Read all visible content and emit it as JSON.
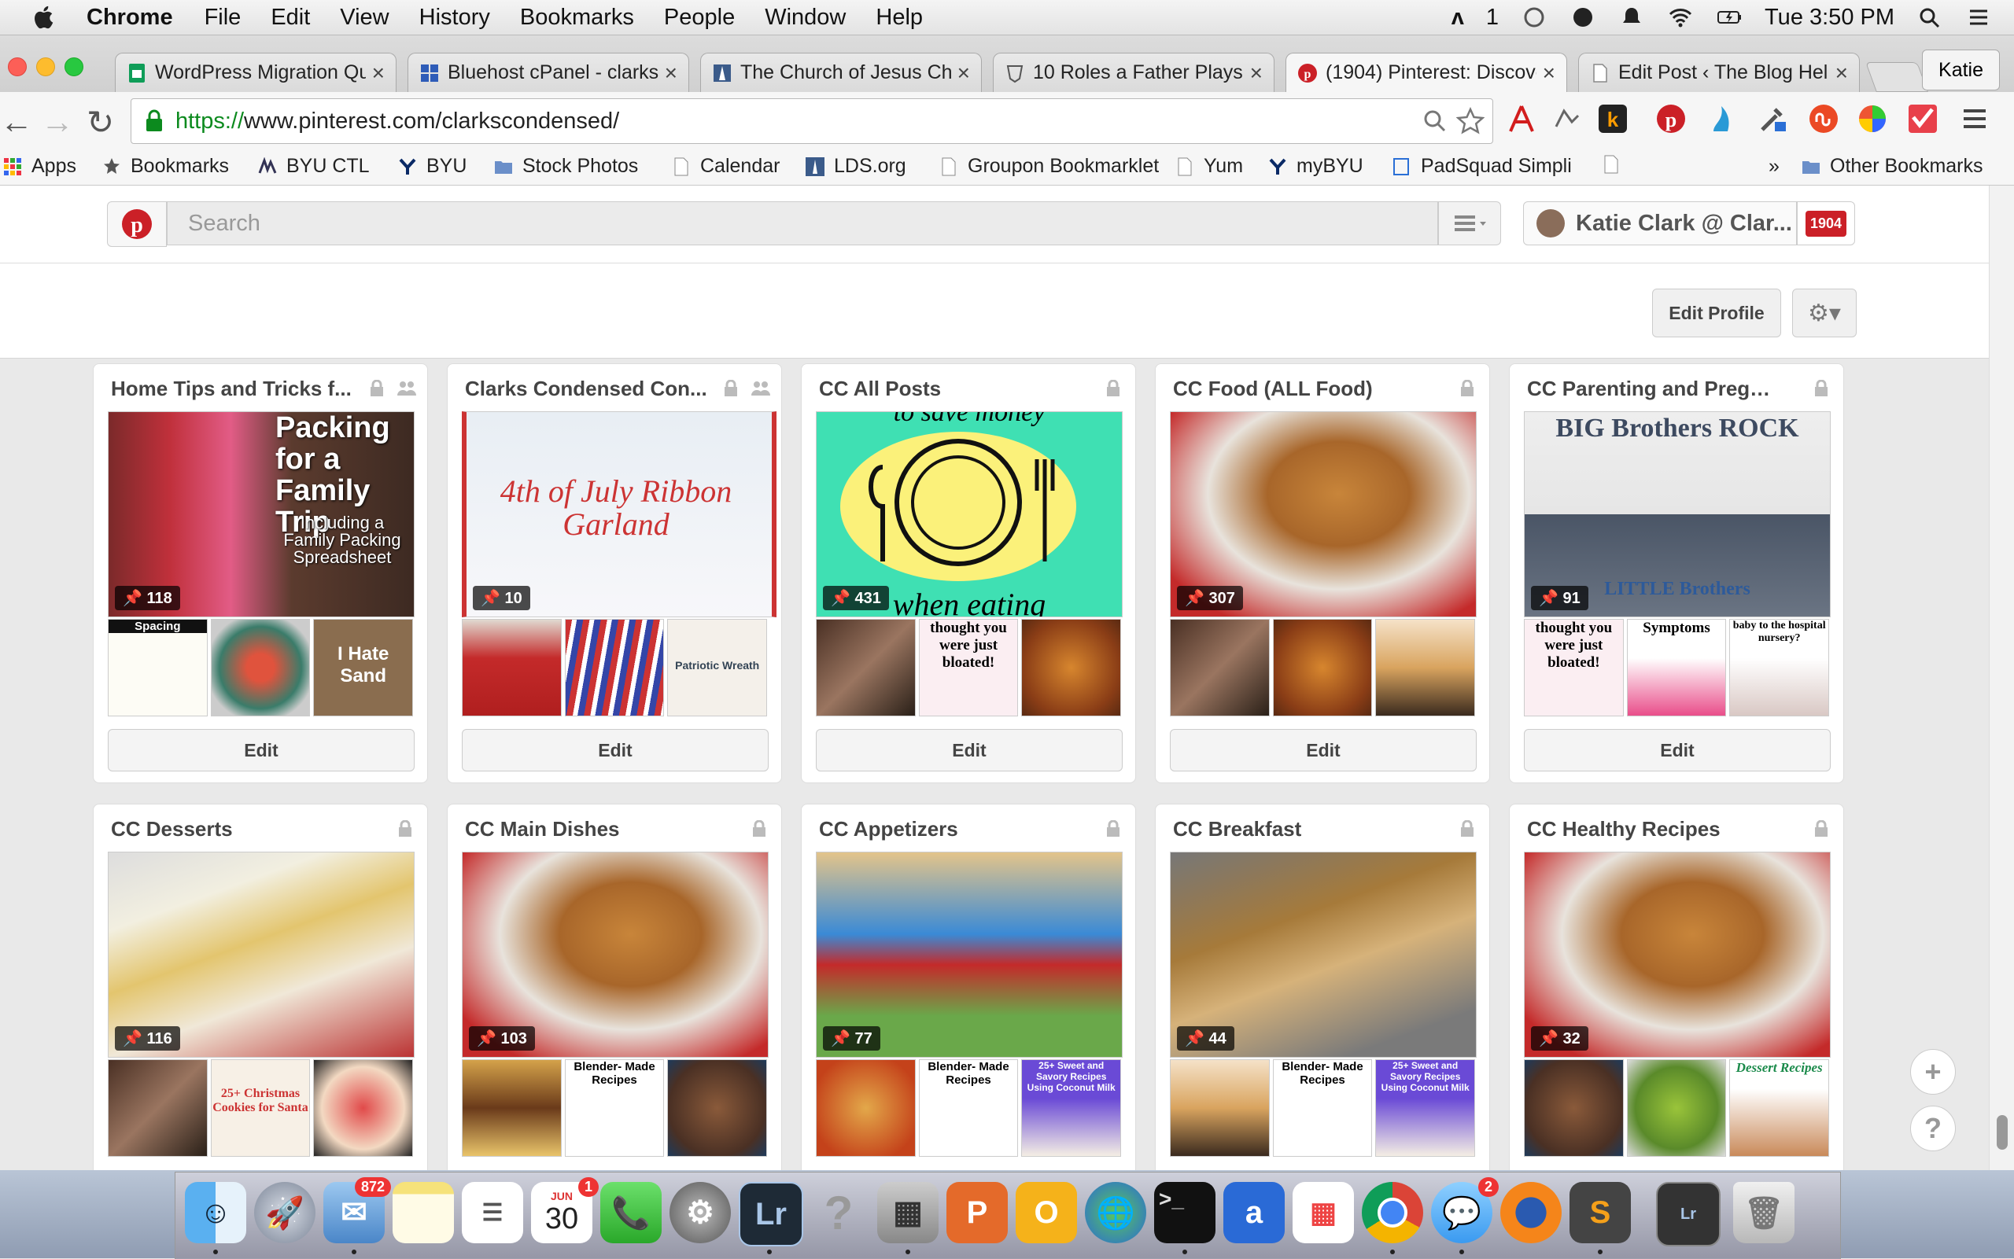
{
  "menubar": {
    "app": "Chrome",
    "items": [
      "File",
      "Edit",
      "View",
      "History",
      "Bookmarks",
      "People",
      "Window",
      "Help"
    ],
    "status_num": "1",
    "clock": "Tue 3:50 PM"
  },
  "tabs": [
    {
      "title": "WordPress Migration Que"
    },
    {
      "title": "Bluehost cPanel - clarksc"
    },
    {
      "title": "The Church of Jesus Chri"
    },
    {
      "title": "10 Roles a Father Plays i"
    },
    {
      "title": "(1904) Pinterest: Discove"
    },
    {
      "title": "Edit Post ‹ The Blog Help"
    }
  ],
  "profile_name": "Katie",
  "url": {
    "scheme": "https://",
    "host_path": "www.pinterest.com/clarkscondensed/"
  },
  "bookmarks": [
    "Apps",
    "Bookmarks",
    "BYU CTL",
    "BYU",
    "Stock Photos",
    "Calendar",
    "LDS.org",
    "Groupon Bookmarklet",
    "Yum",
    "myBYU",
    "PadSquad Simpli",
    "Other Bookmarks"
  ],
  "bookmarks_overflow": "»",
  "pinterest": {
    "search_placeholder": "Search",
    "user_label": "Katie Clark @ Clar...",
    "notif_count": "1904",
    "edit_profile": "Edit Profile"
  },
  "boards": [
    {
      "title": "Home Tips and Tricks f...",
      "count": "118",
      "edit": "Edit",
      "cover_text": "Packing for a Family Trip",
      "cover_sub": "Including a Family Packing Spreadsheet",
      "thumb_texts": [
        "Spacing",
        "",
        "I Hate Sand"
      ]
    },
    {
      "title": "Clarks Condensed Con...",
      "count": "10",
      "edit": "Edit",
      "cover_text": "4th of July Ribbon Garland",
      "cover_sub": "",
      "thumb_texts": [
        "",
        "",
        "Patriotic Wreath"
      ]
    },
    {
      "title": "CC All Posts",
      "count": "431",
      "edit": "Edit",
      "cover_text": "when eating",
      "cover_sub": "to save money",
      "thumb_texts": [
        "",
        "thought you were just bloated!",
        ""
      ]
    },
    {
      "title": "CC Food (ALL Food)",
      "count": "307",
      "edit": "Edit",
      "cover_text": "",
      "cover_sub": "",
      "thumb_texts": [
        "",
        "",
        ""
      ]
    },
    {
      "title": "CC Parenting and Pregnan...",
      "count": "91",
      "edit": "Edit",
      "cover_text": "BIG Brothers ROCK",
      "cover_sub": "LITTLE Brothers",
      "thumb_texts": [
        "thought you were just bloated!",
        "Symptoms",
        "baby to the hospital nursery?"
      ]
    },
    {
      "title": "CC Desserts",
      "count": "116",
      "edit": "",
      "cover_text": "",
      "cover_sub": "",
      "thumb_texts": [
        "",
        "25+ Christmas Cookies for Santa",
        ""
      ]
    },
    {
      "title": "CC Main Dishes",
      "count": "103",
      "edit": "",
      "cover_text": "",
      "cover_sub": "",
      "thumb_texts": [
        "",
        "Blender- Made Recipes",
        ""
      ]
    },
    {
      "title": "CC Appetizers",
      "count": "77",
      "edit": "",
      "cover_text": "",
      "cover_sub": "",
      "thumb_texts": [
        "",
        "Blender- Made Recipes",
        "25+ Sweet and Savory Recipes Using Coconut Milk"
      ]
    },
    {
      "title": "CC Breakfast",
      "count": "44",
      "edit": "",
      "cover_text": "",
      "cover_sub": "",
      "thumb_texts": [
        "",
        "Blender- Made Recipes",
        "25+ Sweet and Savory Recipes Using Coconut Milk"
      ]
    },
    {
      "title": "CC Healthy Recipes",
      "count": "32",
      "edit": "",
      "cover_text": "",
      "cover_sub": "",
      "thumb_texts": [
        "",
        "",
        "Dessert Recipes"
      ]
    }
  ],
  "dock": {
    "mail_badge": "872",
    "cal_month": "JUN",
    "cal_day": "30",
    "cal_badge": "1",
    "msg_badge": "2",
    "lr": "Lr"
  }
}
